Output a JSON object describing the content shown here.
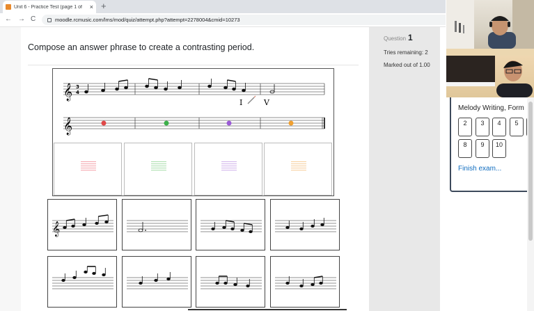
{
  "browser": {
    "tab_title": "Unit 6 - Practice Test (page 1 of",
    "tab_close": "×",
    "new_tab": "+",
    "url": "moodle.rcmusic.com/lms/mod/quiz/attempt.php?attempt=2278004&cmid=10273",
    "nav_back": "←",
    "nav_forward": "→",
    "nav_reload": "C"
  },
  "question": {
    "text": "Compose an answer phrase to create a contrasting period."
  },
  "info": {
    "label": "Question",
    "number": "1",
    "tries": "Tries remaining: 2",
    "marked": "Marked out of 1.00"
  },
  "score": {
    "time_sig_top": "3",
    "time_sig_bottom": "4",
    "numeral_one": "I",
    "numeral_two": "V",
    "dot_colors": [
      "#e04848",
      "#3cb04a",
      "#9b5bd6",
      "#f0a030"
    ],
    "cell_line_colors": [
      "#f4a0a8",
      "#a6dca8",
      "#cfb0ea",
      "#f6cc98"
    ]
  },
  "quiz_nav": {
    "title": "Melody Writing, Form",
    "buttons": [
      "2",
      "3",
      "4",
      "5",
      "",
      "8",
      "9",
      "10"
    ],
    "finish": "Finish exam..."
  },
  "icons": {
    "tab_favicon": "moodle-logo-icon",
    "lock": "lock-icon",
    "treble_clef": "treble-clef-icon",
    "pencil": "pencil-icon"
  }
}
